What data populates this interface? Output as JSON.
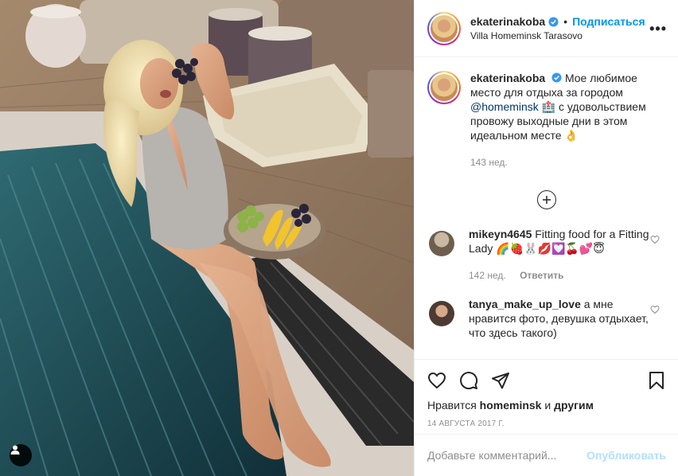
{
  "post": {
    "username": "ekaterinakoba",
    "follow_dot": "•",
    "follow_label": "Подписаться",
    "location": "Villa Homeminsk Tarasovo",
    "more_label": "•••"
  },
  "caption": {
    "username": "ekaterinakoba",
    "text_part1": "Мое любимое место для отдыха за городом",
    "mention": "@homeminsk",
    "text_part2": "🏥 с удовольствием провожу выходные дни в этом идеальном месте 👌",
    "time": "143 нед."
  },
  "comments": [
    {
      "username": "mikeyn4645",
      "text": "Fitting food for a Fitting Lady 🌈🍓🐰💋💟🍒💕😇",
      "time": "142 нед.",
      "reply_label": "Ответить"
    },
    {
      "username": "tanya_make_up_love",
      "text": "а мне нравится фото, девушка отдыхает, что здесь такого)"
    }
  ],
  "likes": {
    "prefix": "Нравится",
    "user": "homeminsk",
    "middle": "и",
    "others": "другим"
  },
  "date": "14 августа 2017 г.",
  "add_comment": {
    "placeholder": "Добавьте комментарий...",
    "publish_label": "Опубликовать"
  },
  "colors": {
    "accent": "#0095f6",
    "publish_disabled": "#b2dffc",
    "muted": "#8e8e8e",
    "pool_water": "#1f4a55"
  },
  "icons": [
    "verified-icon",
    "more-options-icon",
    "load-more-icon",
    "heart-icon",
    "comment-icon",
    "share-icon",
    "bookmark-icon",
    "user-tag-icon"
  ]
}
